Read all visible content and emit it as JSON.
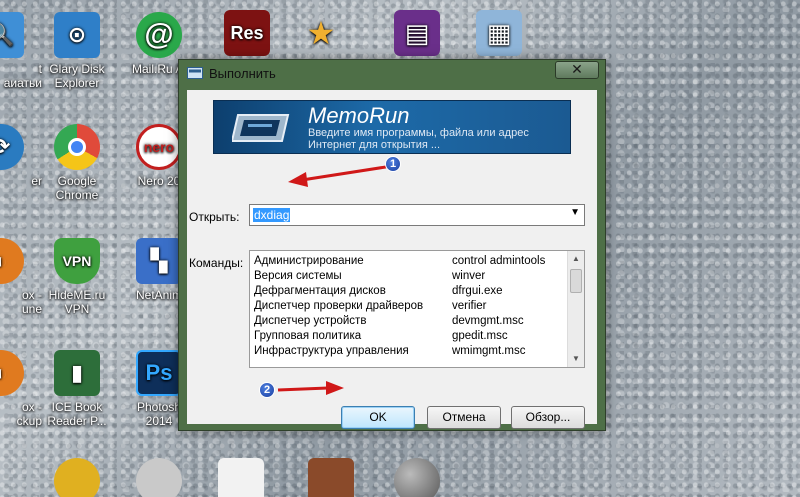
{
  "desktop": {
    "icons": [
      {
        "label": "t\nаиатьи",
        "color": "#3f8fd6",
        "glyph": "🔍"
      },
      {
        "label": "Glary Disk\nExplorer",
        "color": "#2f7fc8",
        "glyph": "⊙"
      },
      {
        "label": "Mail.Ru Al",
        "color": "#2aa84a",
        "glyph": "@"
      },
      {
        "label": "",
        "color": "#7d1212",
        "glyph": "Res"
      },
      {
        "label": "",
        "color": "#b58a2a",
        "glyph": "★"
      },
      {
        "label": "",
        "color": "#6a2f8a",
        "glyph": "▤"
      },
      {
        "label": "",
        "color": "#8fb5d9",
        "glyph": "▦"
      },
      {
        "label": "er",
        "color": "#2a7bc0",
        "glyph": "⟳"
      },
      {
        "label": "Google\nChrome",
        "color": "#e04a3a",
        "glyph": "◉"
      },
      {
        "label": "Nero 20",
        "color": "#c21f1f",
        "glyph": "nero"
      },
      {
        "label": "ox -\nune",
        "color": "#e07a1f",
        "glyph": "◐"
      },
      {
        "label": "HideME.ru VPN",
        "color": "#3fa03f",
        "glyph": "VPN"
      },
      {
        "label": "NetAnim",
        "color": "#3a6fc8",
        "glyph": "▚"
      },
      {
        "label": "ox -\nckup",
        "color": "#e07a1f",
        "glyph": "◐"
      },
      {
        "label": "ICE Book\nReader P...",
        "color": "#2d6e3a",
        "glyph": "▮"
      },
      {
        "label": "Photosh\n2014",
        "color": "#0e2f5a",
        "glyph": "Ps"
      }
    ]
  },
  "window": {
    "title": "Выполнить",
    "close_symbol": "✕",
    "banner": {
      "brand": "MemoRun",
      "hint": "Введите имя программы, файла или адрес Интернет для открытия ..."
    },
    "open_label": "Открыть:",
    "open_value": "dxdiag",
    "commands_label": "Команды:",
    "commands": [
      {
        "name": "Администрирование",
        "cmd": "control admintools"
      },
      {
        "name": "Версия системы",
        "cmd": "winver"
      },
      {
        "name": "Дефрагментация дисков",
        "cmd": "dfrgui.exe"
      },
      {
        "name": "Диспетчер проверки драйверов",
        "cmd": "verifier"
      },
      {
        "name": "Диспетчер устройств",
        "cmd": "devmgmt.msc"
      },
      {
        "name": "Групповая политика",
        "cmd": "gpedit.msc"
      },
      {
        "name": "Инфраструктура управления",
        "cmd": "wmimgmt.msc"
      }
    ],
    "buttons": {
      "ok": "OK",
      "cancel": "Отмена",
      "browse": "Обзор..."
    }
  },
  "annotations": {
    "step1": "1",
    "step2": "2",
    "arrow_color": "#d01818"
  }
}
